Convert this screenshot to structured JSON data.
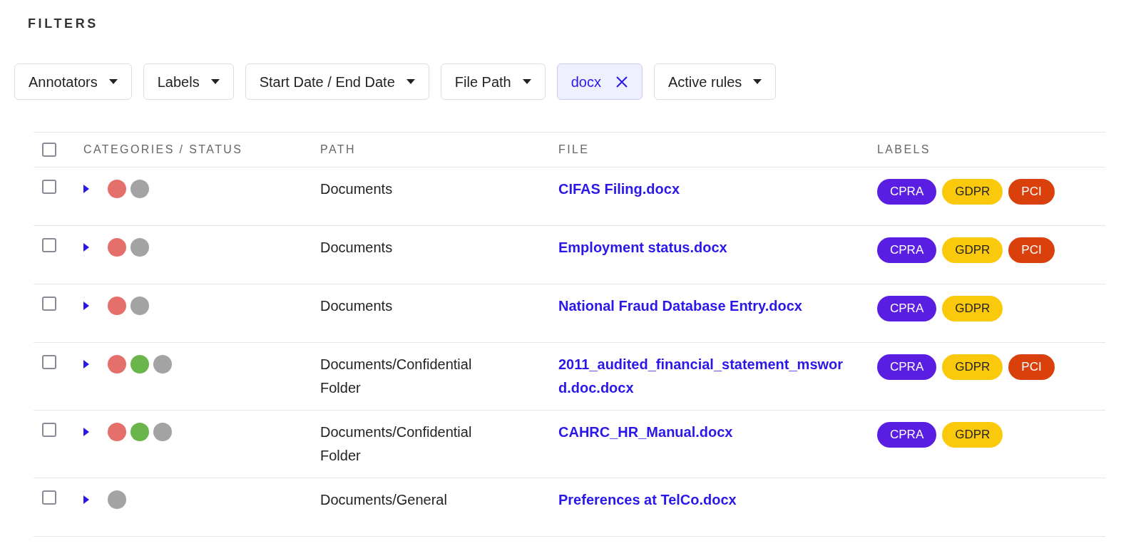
{
  "heading": "FILTERS",
  "filters": [
    {
      "kind": "dropdown",
      "label": "Annotators"
    },
    {
      "kind": "dropdown",
      "label": "Labels"
    },
    {
      "kind": "dropdown",
      "label": "Start Date / End Date"
    },
    {
      "kind": "dropdown",
      "label": "File Path"
    },
    {
      "kind": "chip",
      "label": "docx"
    },
    {
      "kind": "dropdown",
      "label": "Active rules"
    }
  ],
  "table": {
    "select_all": {
      "checked": false
    },
    "columns": [
      "CATEGORIES / STATUS",
      "PATH",
      "FILE",
      "LABELS"
    ],
    "rows": [
      {
        "checked": false,
        "status": [
          {
            "color": "#e5706b"
          },
          {
            "color": "#a3a3a3"
          }
        ],
        "path": "Documents",
        "file": "CIFAS Filing.docx",
        "labels": [
          {
            "text": "CPRA",
            "color": "#5a1ee3"
          },
          {
            "text": "GDPR",
            "color": "#fbc90c"
          },
          {
            "text": "PCI",
            "color": "#d9400b"
          }
        ]
      },
      {
        "checked": false,
        "status": [
          {
            "color": "#e5706b"
          },
          {
            "color": "#a3a3a3"
          }
        ],
        "path": "Documents",
        "file": "Employment status.docx",
        "labels": [
          {
            "text": "CPRA",
            "color": "#5a1ee3"
          },
          {
            "text": "GDPR",
            "color": "#fbc90c"
          },
          {
            "text": "PCI",
            "color": "#d9400b"
          }
        ]
      },
      {
        "checked": false,
        "status": [
          {
            "color": "#e5706b"
          },
          {
            "color": "#a3a3a3"
          }
        ],
        "path": "Documents",
        "file": "National Fraud Database Entry.docx",
        "labels": [
          {
            "text": "CPRA",
            "color": "#5a1ee3"
          },
          {
            "text": "GDPR",
            "color": "#fbc90c"
          }
        ]
      },
      {
        "checked": false,
        "status": [
          {
            "color": "#e5706b"
          },
          {
            "color": "#6ab54c"
          },
          {
            "color": "#a3a3a3"
          }
        ],
        "path": "Documents/Confidential Folder",
        "file": "2011_audited_financial_statement_msword.doc.docx",
        "labels": [
          {
            "text": "CPRA",
            "color": "#5a1ee3"
          },
          {
            "text": "GDPR",
            "color": "#fbc90c"
          },
          {
            "text": "PCI",
            "color": "#d9400b"
          }
        ]
      },
      {
        "checked": false,
        "status": [
          {
            "color": "#e5706b"
          },
          {
            "color": "#6ab54c"
          },
          {
            "color": "#a3a3a3"
          }
        ],
        "path": "Documents/Confidential Folder",
        "file": "CAHRC_HR_Manual.docx",
        "labels": [
          {
            "text": "CPRA",
            "color": "#5a1ee3"
          },
          {
            "text": "GDPR",
            "color": "#fbc90c"
          }
        ]
      },
      {
        "checked": false,
        "status": [
          {
            "color": "#a3a3a3"
          }
        ],
        "path": "Documents/General",
        "file": "Preferences at TelCo.docx",
        "labels": []
      }
    ]
  }
}
